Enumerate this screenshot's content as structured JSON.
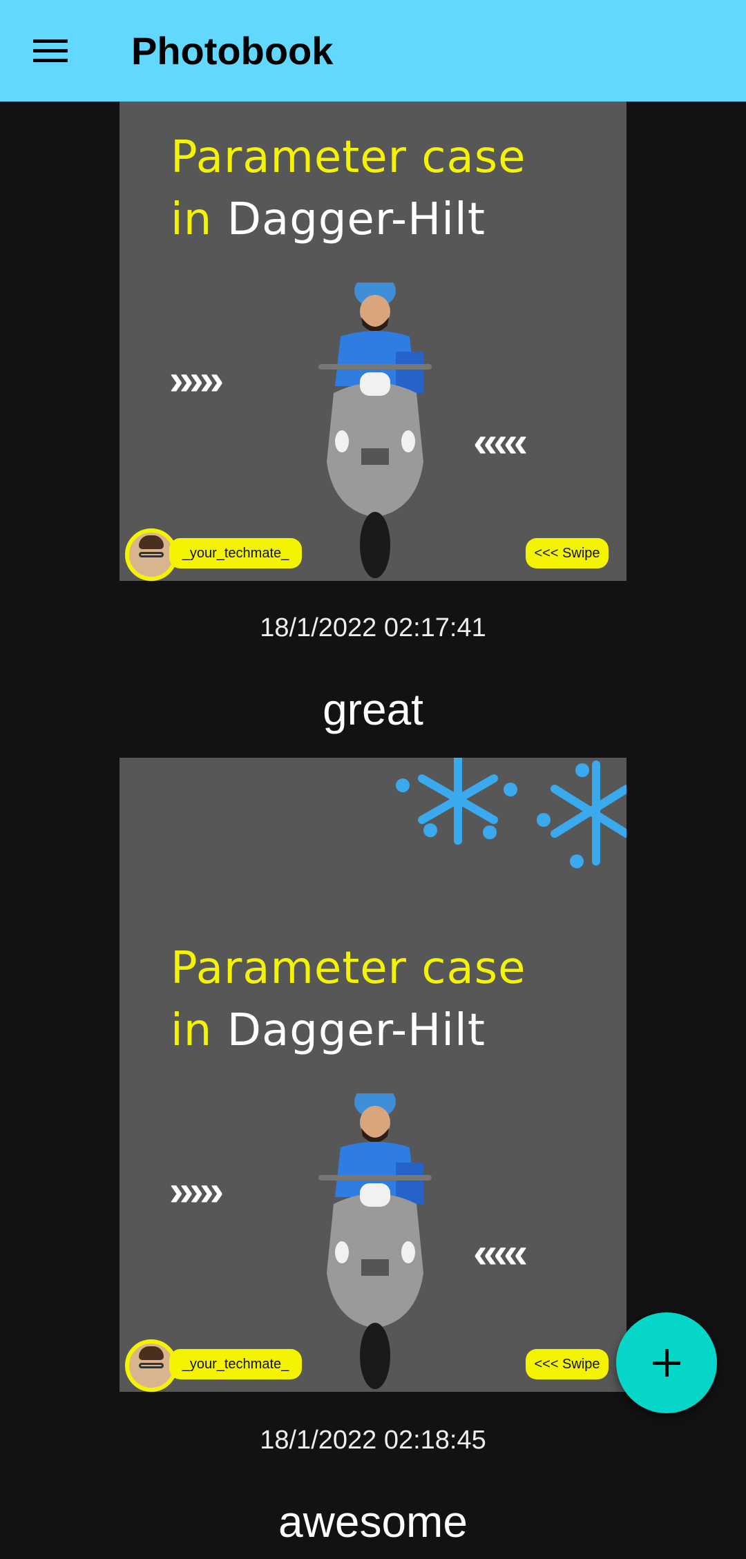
{
  "app_bar": {
    "title": "Photobook",
    "menu_icon": "hamburger-menu-icon",
    "color": "#63d8ff"
  },
  "posts": [
    {
      "image": {
        "headline_line1": "Parameter case",
        "headline_line2_prefix": "in",
        "headline_line2_suffix": "Dagger-Hilt",
        "arrows_right": "›››››",
        "arrows_left": "‹‹‹‹‹",
        "handle": "_your_techmate_",
        "swipe": "<<< Swipe"
      },
      "timestamp": "18/1/2022 02:17:41",
      "caption": "great"
    },
    {
      "image": {
        "headline_line1": "Parameter case",
        "headline_line2_prefix": "in",
        "headline_line2_suffix": "Dagger-Hilt",
        "arrows_right": "›››››",
        "arrows_left": "‹‹‹‹‹",
        "handle": "_your_techmate_",
        "swipe": "<<< Swipe"
      },
      "timestamp": "18/1/2022 02:18:45",
      "caption": "awesome"
    }
  ],
  "fab": {
    "icon": "plus-icon",
    "color": "#06d6c7"
  }
}
